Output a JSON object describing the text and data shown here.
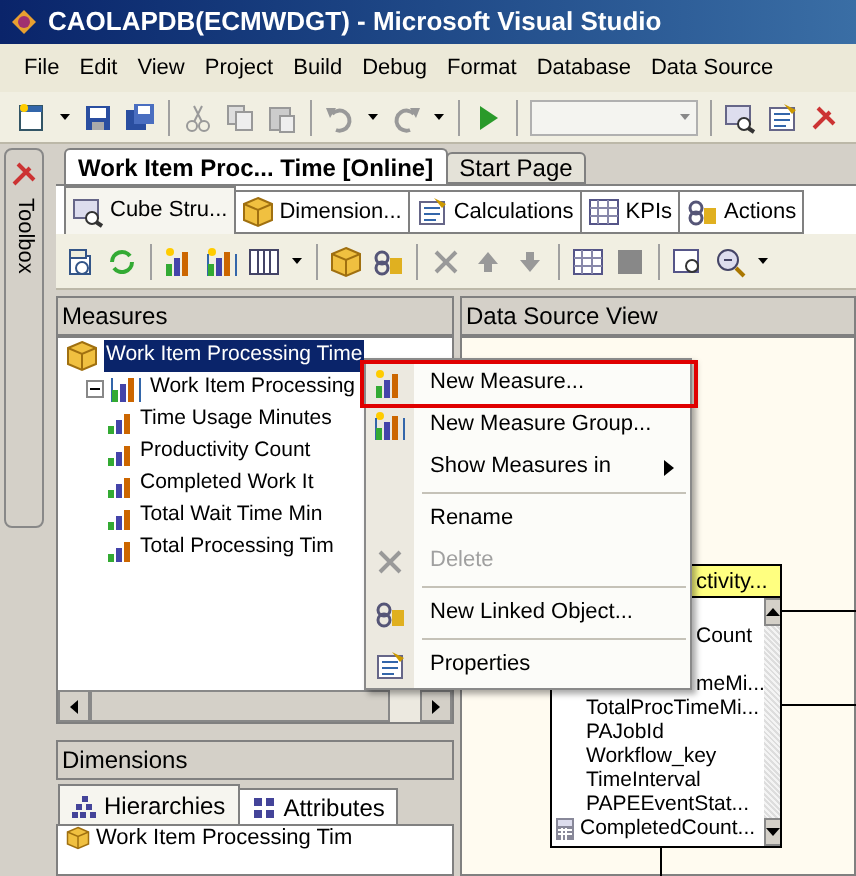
{
  "window": {
    "title": "CAOLAPDB(ECMWDGT) - Microsoft Visual Studio"
  },
  "menu": [
    "File",
    "Edit",
    "View",
    "Project",
    "Build",
    "Debug",
    "Format",
    "Database",
    "Data Source"
  ],
  "toolbox": {
    "label": "Toolbox"
  },
  "document_tabs": [
    {
      "label": "Work Item Proc... Time [Online]",
      "selected": true
    },
    {
      "label": "Start Page",
      "selected": false
    }
  ],
  "designer_tabs": [
    {
      "label": "Cube Stru...",
      "selected": true
    },
    {
      "label": "Dimension...",
      "selected": false
    },
    {
      "label": "Calculations",
      "selected": false
    },
    {
      "label": "KPIs",
      "selected": false
    },
    {
      "label": "Actions",
      "selected": false
    }
  ],
  "measures": {
    "title": "Measures",
    "tree": [
      {
        "label": "Work Item Processing Time",
        "kind": "cube",
        "selected": true,
        "children": [
          {
            "label": "Work Item Processing",
            "kind": "group",
            "selected": false,
            "expanded": true,
            "children": [
              {
                "label": "Time Usage Minutes",
                "kind": "measure",
                "selected": false
              },
              {
                "label": "Productivity Count",
                "kind": "measure",
                "selected": false
              },
              {
                "label": "Completed Work It",
                "kind": "measure",
                "selected": false
              },
              {
                "label": "Total Wait Time Min",
                "kind": "measure",
                "selected": false
              },
              {
                "label": "Total Processing Tim",
                "kind": "measure",
                "selected": false
              }
            ]
          }
        ]
      }
    ]
  },
  "dimensions": {
    "title": "Dimensions",
    "tabs": [
      {
        "label": "Hierarchies",
        "selected": true
      },
      {
        "label": "Attributes",
        "selected": false
      }
    ],
    "items": [
      "Work Item Processing Tim"
    ]
  },
  "data_source_view": {
    "title": "Data Source View",
    "table": {
      "title": "ctivity...",
      "rows": [
        {
          "label": "Count",
          "kind": "column"
        },
        {
          "label": "meMi...",
          "kind": "column"
        },
        {
          "label": "TotalProcTimeMi...",
          "kind": "column"
        },
        {
          "label": "PAJobId",
          "kind": "column"
        },
        {
          "label": "Workflow_key",
          "kind": "column"
        },
        {
          "label": "TimeInterval",
          "kind": "column"
        },
        {
          "label": "PAPEEventStat...",
          "kind": "column"
        },
        {
          "label": "CompletedCount...",
          "kind": "calculated"
        }
      ]
    }
  },
  "context_menu": [
    {
      "kind": "item",
      "label": "New Measure...",
      "highlighted": true,
      "disabled": false,
      "submenu": false
    },
    {
      "kind": "item",
      "label": "New Measure Group...",
      "highlighted": false,
      "disabled": false,
      "submenu": false
    },
    {
      "kind": "item",
      "label": "Show Measures in",
      "highlighted": false,
      "disabled": false,
      "submenu": true
    },
    {
      "kind": "separator"
    },
    {
      "kind": "item",
      "label": "Rename",
      "highlighted": false,
      "disabled": false,
      "submenu": false
    },
    {
      "kind": "item",
      "label": "Delete",
      "highlighted": false,
      "disabled": true,
      "submenu": false
    },
    {
      "kind": "separator"
    },
    {
      "kind": "item",
      "label": "New Linked Object...",
      "highlighted": false,
      "disabled": false,
      "submenu": false
    },
    {
      "kind": "separator"
    },
    {
      "kind": "item",
      "label": "Properties",
      "highlighted": false,
      "disabled": false,
      "submenu": false
    }
  ]
}
